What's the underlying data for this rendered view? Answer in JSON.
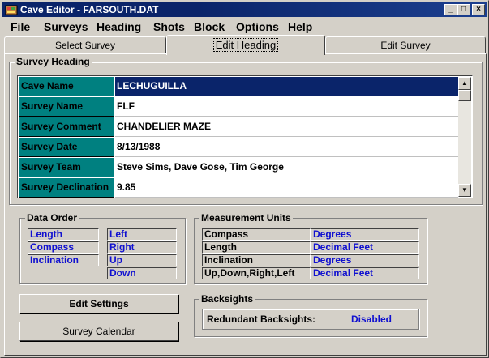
{
  "window": {
    "title": "Cave Editor - FARSOUTH.DAT",
    "min_glyph": "_",
    "max_glyph": "□",
    "close_glyph": "×"
  },
  "menu": {
    "items": [
      {
        "label": "File"
      },
      {
        "label": "Surveys"
      },
      {
        "label": "Heading"
      },
      {
        "label": "Shots"
      },
      {
        "label": "Block"
      },
      {
        "label": "Options"
      },
      {
        "label": "Help"
      }
    ]
  },
  "tabs": [
    {
      "label": "Select Survey",
      "active": false
    },
    {
      "label": "Edit Heading",
      "active": true
    },
    {
      "label": "Edit Survey",
      "active": false
    }
  ],
  "survey_heading": {
    "group_label": "Survey Heading",
    "rows": [
      {
        "key": "Cave Name",
        "value": "LECHUGUILLA",
        "selected": true
      },
      {
        "key": "Survey Name",
        "value": "FLF",
        "selected": false
      },
      {
        "key": "Survey Comment",
        "value": "CHANDELIER MAZE",
        "selected": false
      },
      {
        "key": "Survey Date",
        "value": "8/13/1988",
        "selected": false
      },
      {
        "key": "Survey Team",
        "value": "Steve Sims, Dave Gose, Tim George",
        "selected": false
      },
      {
        "key": "Survey Declination",
        "value": "9.85",
        "selected": false
      }
    ],
    "scroll_up_glyph": "▲",
    "scroll_down_glyph": "▼"
  },
  "data_order": {
    "group_label": "Data Order",
    "left_column": [
      "Length",
      "Compass",
      "Inclination"
    ],
    "right_column": [
      "Left",
      "Right",
      "Up",
      "Down"
    ]
  },
  "measurement_units": {
    "group_label": "Measurement Units",
    "rows": [
      {
        "name": "Compass",
        "unit": "Degrees"
      },
      {
        "name": "Length",
        "unit": "Decimal Feet"
      },
      {
        "name": "Inclination",
        "unit": "Degrees"
      },
      {
        "name": "Up,Down,Right,Left",
        "unit": "Decimal Feet"
      }
    ]
  },
  "buttons": {
    "edit_settings": "Edit Settings",
    "survey_calendar": "Survey Calendar"
  },
  "backsights": {
    "group_label": "Backsights",
    "label": "Redundant Backsights:",
    "value": "Disabled"
  },
  "colors": {
    "title_bar": "#0a246a",
    "grid_key_bg": "#008080",
    "selection": "#0a246a",
    "value_blue": "#1010d0",
    "face": "#d4d0c8"
  }
}
